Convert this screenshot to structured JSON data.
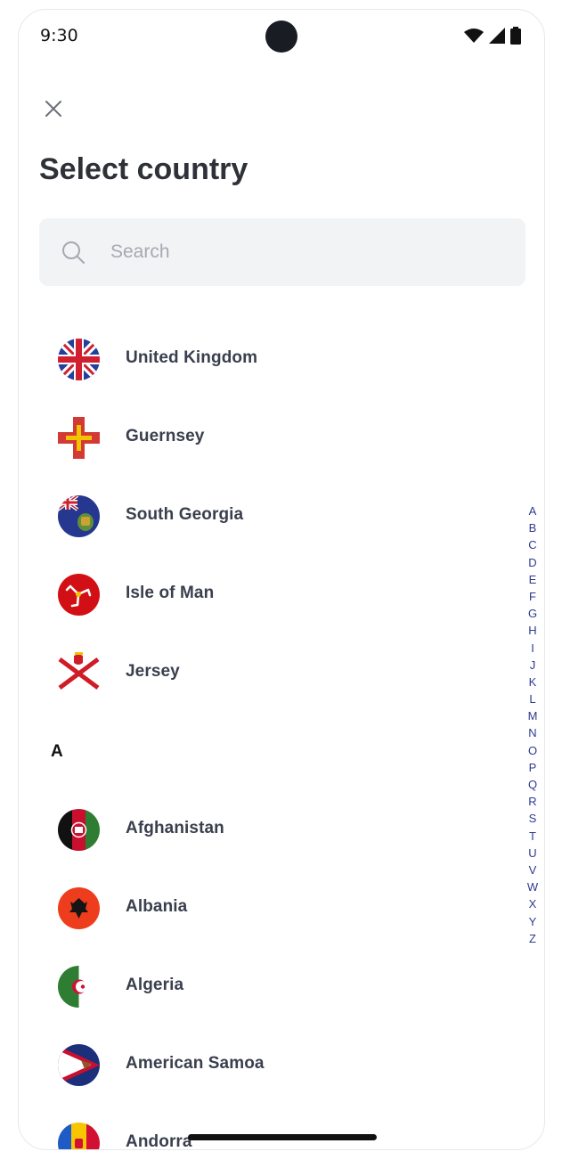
{
  "status_bar": {
    "time": "9:30",
    "icons": [
      "wifi-icon",
      "signal-icon",
      "battery-icon"
    ]
  },
  "header": {
    "close_icon": "close-icon",
    "title": "Select country"
  },
  "search": {
    "placeholder": "Search",
    "value": "",
    "icon": "search-icon"
  },
  "pinned_countries": [
    {
      "name": "United Kingdom",
      "flag": "uk-flag"
    },
    {
      "name": "Guernsey",
      "flag": "guernsey-flag"
    },
    {
      "name": "South Georgia",
      "flag": "south-georgia-flag"
    },
    {
      "name": "Isle of Man",
      "flag": "isle-of-man-flag"
    },
    {
      "name": "Jersey",
      "flag": "jersey-flag"
    }
  ],
  "sections": [
    {
      "letter": "A",
      "countries": [
        {
          "name": "Afghanistan",
          "flag": "afghanistan-flag"
        },
        {
          "name": "Albania",
          "flag": "albania-flag"
        },
        {
          "name": "Algeria",
          "flag": "algeria-flag"
        },
        {
          "name": "American Samoa",
          "flag": "american-samoa-flag"
        },
        {
          "name": "Andorra",
          "flag": "andorra-flag"
        }
      ]
    }
  ],
  "alphabet_index": [
    "A",
    "B",
    "C",
    "D",
    "E",
    "F",
    "G",
    "H",
    "I",
    "J",
    "K",
    "L",
    "M",
    "N",
    "O",
    "P",
    "Q",
    "R",
    "S",
    "T",
    "U",
    "V",
    "W",
    "X",
    "Y",
    "Z"
  ],
  "colors": {
    "title": "#2e3138",
    "country_text": "#3a3f4e",
    "index_text": "#2f3b8f",
    "search_bg": "#f2f3f5",
    "placeholder": "#a5a9b1"
  }
}
